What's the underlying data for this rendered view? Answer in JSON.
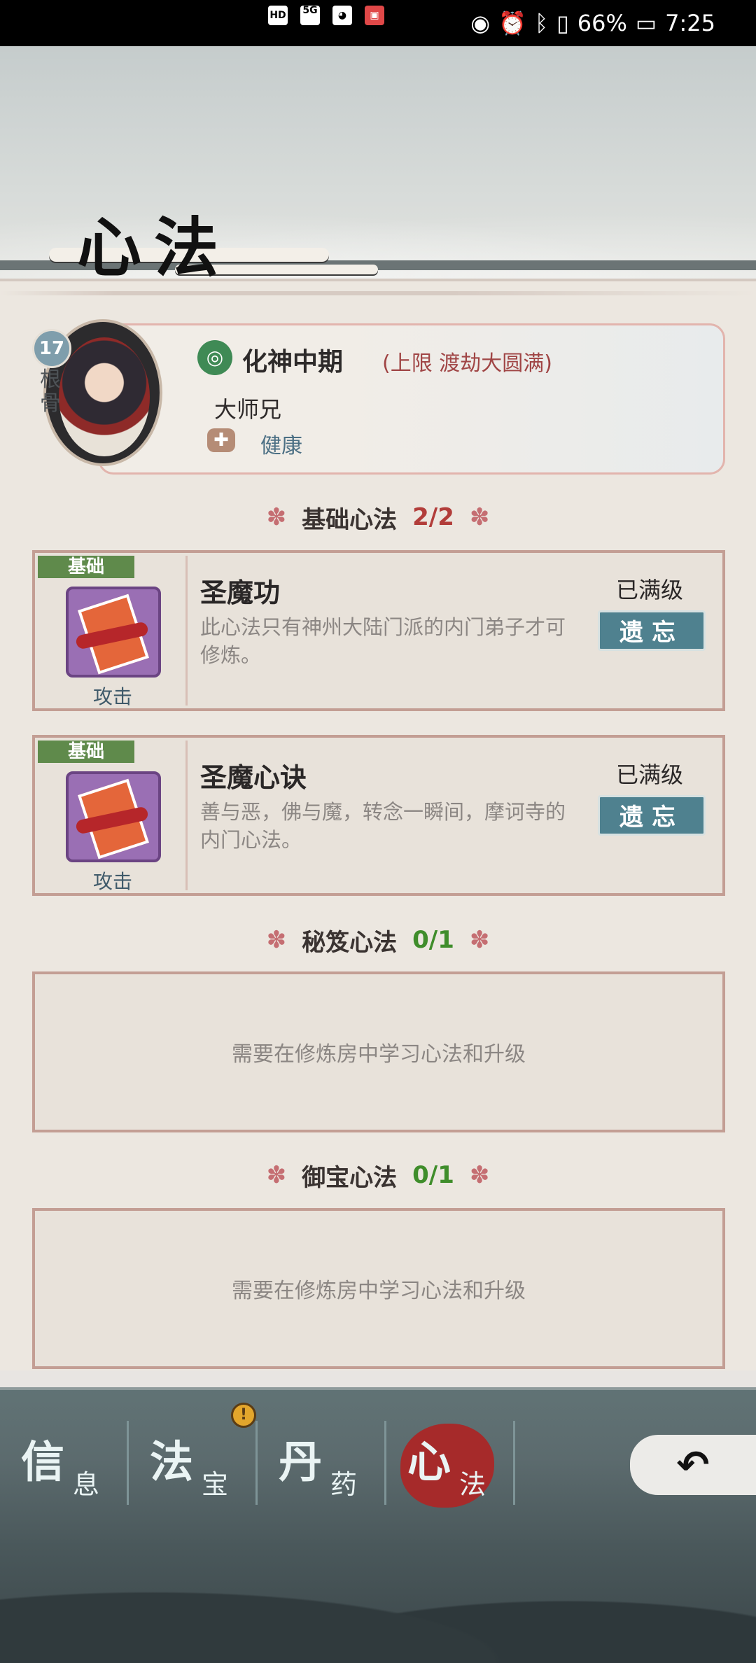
{
  "status_bar": {
    "left_icons": [
      "HD",
      "5G",
      "qq-icon",
      "app-icon"
    ],
    "battery": "66%",
    "time": "7:25"
  },
  "header": {
    "title": "心法"
  },
  "hero": {
    "root_value": "17",
    "root_label": "根骨",
    "realm": "化神中期",
    "realm_limit": "(上限 渡劫大圆满)",
    "name": "大师兄",
    "health": "健康"
  },
  "sections": {
    "basic": {
      "title": "基础心法",
      "count": "2/2"
    },
    "secret": {
      "title": "秘笈心法",
      "count": "0/1",
      "empty_text": "需要在修炼房中学习心法和升级"
    },
    "treasure": {
      "title": "御宝心法",
      "count": "0/1",
      "empty_text": "需要在修炼房中学习心法和升级"
    }
  },
  "skills": [
    {
      "tag": "基础",
      "title": "圣魔功",
      "desc": "此心法只有神州大陆门派的内门弟子才可修炼。",
      "type": "攻击",
      "level": "已满级",
      "forget": "遗忘"
    },
    {
      "tag": "基础",
      "title": "圣魔心诀",
      "desc": "善与恶，佛与魔，转念一瞬间，摩诃寺的内门心法。",
      "type": "攻击",
      "level": "已满级",
      "forget": "遗忘"
    }
  ],
  "nav": {
    "tabs": [
      {
        "big": "信",
        "small": "息"
      },
      {
        "big": "法",
        "small": "宝"
      },
      {
        "big": "丹",
        "small": "药"
      },
      {
        "big": "心",
        "small": "法"
      }
    ],
    "alert": "!",
    "back": "↶"
  },
  "colors": {
    "accent_red": "#b23d3a",
    "accent_green": "#3f8d2b",
    "button_teal": "#4f818f"
  }
}
